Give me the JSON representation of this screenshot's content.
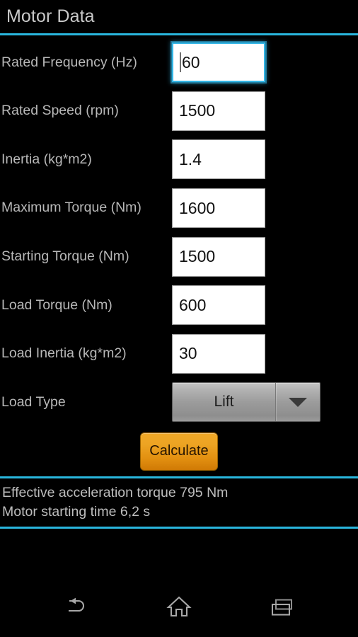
{
  "app": {
    "title": "Motor Data",
    "accent_color": "#29b6dd",
    "background_color": "#000000",
    "label_color": "#b8b8b8",
    "button_color": "#e8960f"
  },
  "form": {
    "fields": [
      {
        "label": "Rated Frequency (Hz)",
        "value": "60",
        "focused": true
      },
      {
        "label": "Rated Speed (rpm)",
        "value": "1500",
        "focused": false
      },
      {
        "label": "Inertia (kg*m2)",
        "value": "1.4",
        "focused": false
      },
      {
        "label": "Maximum Torque (Nm)",
        "value": "1600",
        "focused": false
      },
      {
        "label": "Starting Torque (Nm)",
        "value": "1500",
        "focused": false
      },
      {
        "label": "Load Torque (Nm)",
        "value": "600",
        "focused": false
      },
      {
        "label": "Load Inertia (kg*m2)",
        "value": "30",
        "focused": false
      }
    ],
    "load_type": {
      "label": "Load Type",
      "selected": "Lift",
      "dropdown_icon": "chevron-down-icon"
    },
    "calculate_button": "Calculate"
  },
  "results": {
    "line1": "Effective acceleration torque 795 Nm",
    "line2": "Motor starting time 6,2 s"
  },
  "navbar": {
    "back": "back-icon",
    "home": "home-icon",
    "recents": "recents-icon"
  }
}
